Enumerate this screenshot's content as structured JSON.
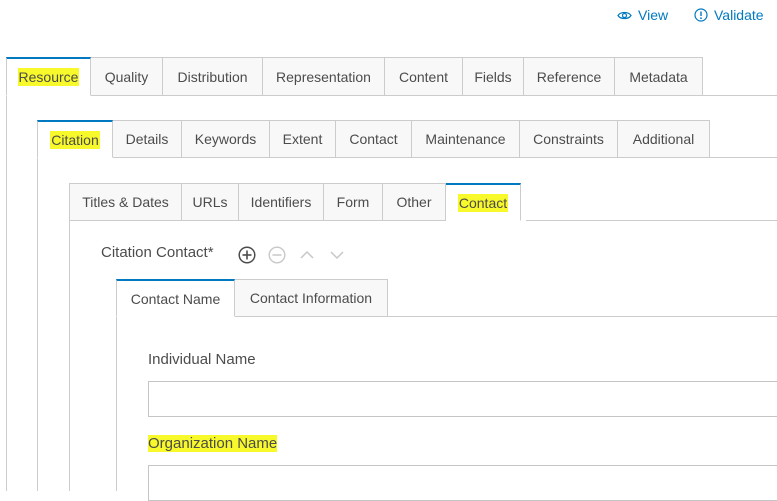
{
  "top_links": {
    "view_label": "View",
    "view_icon": "eye-icon",
    "validate_label": "Validate",
    "validate_icon": "alert-circle-icon",
    "link_color": "#0079c1"
  },
  "main_tabs": [
    {
      "label": "Resource",
      "active": true,
      "highlighted": true
    },
    {
      "label": "Quality"
    },
    {
      "label": "Distribution"
    },
    {
      "label": "Representation"
    },
    {
      "label": "Content"
    },
    {
      "label": "Fields"
    },
    {
      "label": "Reference"
    },
    {
      "label": "Metadata"
    }
  ],
  "resource_tabs": [
    {
      "label": "Citation",
      "active": true,
      "highlighted": true
    },
    {
      "label": "Details"
    },
    {
      "label": "Keywords"
    },
    {
      "label": "Extent"
    },
    {
      "label": "Contact"
    },
    {
      "label": "Maintenance"
    },
    {
      "label": "Constraints"
    },
    {
      "label": "Additional"
    }
  ],
  "citation_tabs": [
    {
      "label": "Titles & Dates"
    },
    {
      "label": "URLs"
    },
    {
      "label": "Identifiers"
    },
    {
      "label": "Form"
    },
    {
      "label": "Other"
    },
    {
      "label": "Contact",
      "active": true,
      "highlighted": true
    }
  ],
  "citation_contact": {
    "label": "Citation Contact*",
    "controls": [
      {
        "icon": "add-circle-icon",
        "enabled": true
      },
      {
        "icon": "remove-circle-icon",
        "enabled": false
      },
      {
        "icon": "chevron-up-icon",
        "enabled": false
      },
      {
        "icon": "chevron-down-icon",
        "enabled": false
      }
    ]
  },
  "contact_tabs": [
    {
      "label": "Contact Name",
      "active": true
    },
    {
      "label": "Contact Information"
    }
  ],
  "fields": {
    "individual_name_label": "Individual Name",
    "individual_name_value": "",
    "organization_name_label": "Organization Name",
    "organization_name_value": ""
  },
  "colors": {
    "accent": "#0079c1",
    "highlight": "#f7f92a",
    "border": "#cccccc",
    "tab_bg": "#f8f8f8"
  }
}
